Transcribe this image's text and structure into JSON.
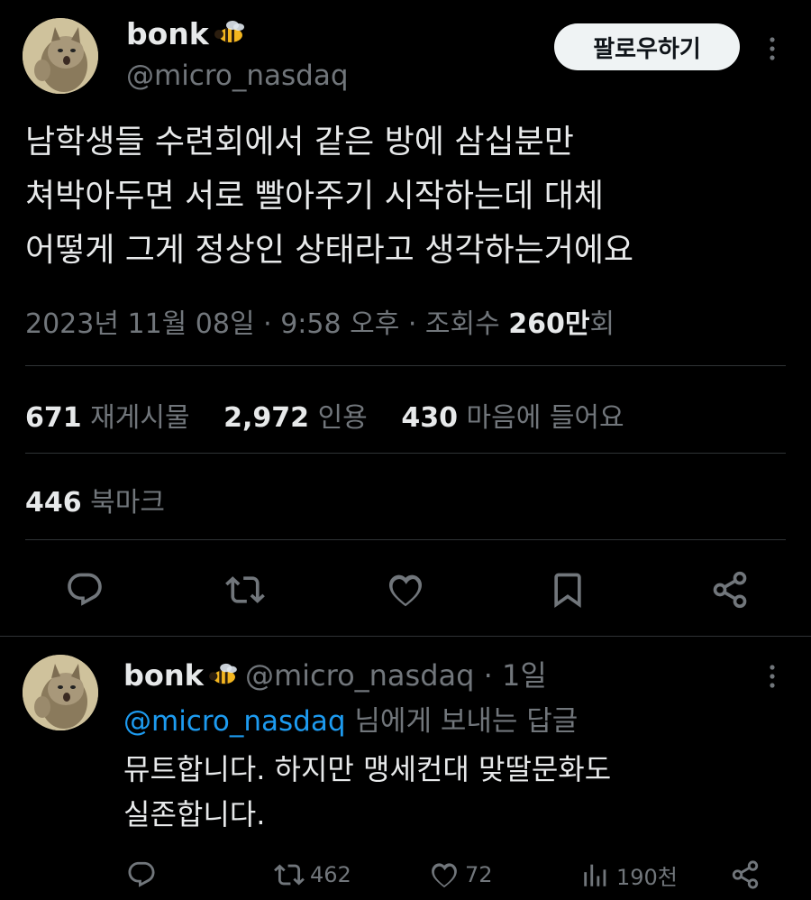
{
  "main_tweet": {
    "display_name": "bonk",
    "handle": "@micro_nasdaq",
    "follow_button": "팔로우하기",
    "text_lines": [
      "남학생들 수련회에서 같은 방에 삼십분만",
      "쳐박아두면 서로 빨아주기 시작하는데 대체",
      "어떻게 그게 정상인 상태라고 생각하는거에요"
    ],
    "meta": {
      "date": "2023년 11월 08일",
      "sep1": " · ",
      "time": "9:58 오후",
      "sep2": " · ",
      "views_label": "조회수 ",
      "views_num": "260만",
      "views_unit": "회"
    },
    "stats": {
      "reposts_num": "671",
      "reposts_label": "재게시물",
      "quotes_num": "2,972",
      "quotes_label": "인용",
      "likes_num": "430",
      "likes_label": "마음에 들어요",
      "bookmarks_num": "446",
      "bookmarks_label": "북마크"
    },
    "action_icons": [
      "reply-icon",
      "repost-icon",
      "like-icon",
      "bookmark-icon",
      "share-icon"
    ]
  },
  "reply_tweet": {
    "display_name": "bonk",
    "handle": "@micro_nasdaq",
    "sep": " · ",
    "time": "1일",
    "reply_to_handle": "@micro_nasdaq",
    "reply_to_suffix": " 님에게 보내는 답글",
    "text_lines": [
      "뮤트합니다. 하지만 맹세컨대 맞딸문화도",
      "실존합니다."
    ],
    "counts": {
      "reposts": "462",
      "likes": "72",
      "views": "190천"
    }
  },
  "colors": {
    "background": "#000000",
    "text": "#e7e9ea",
    "muted": "#71767b",
    "link": "#1d9bf0",
    "divider": "#2f3336",
    "follow_bg": "#eff3f4"
  }
}
